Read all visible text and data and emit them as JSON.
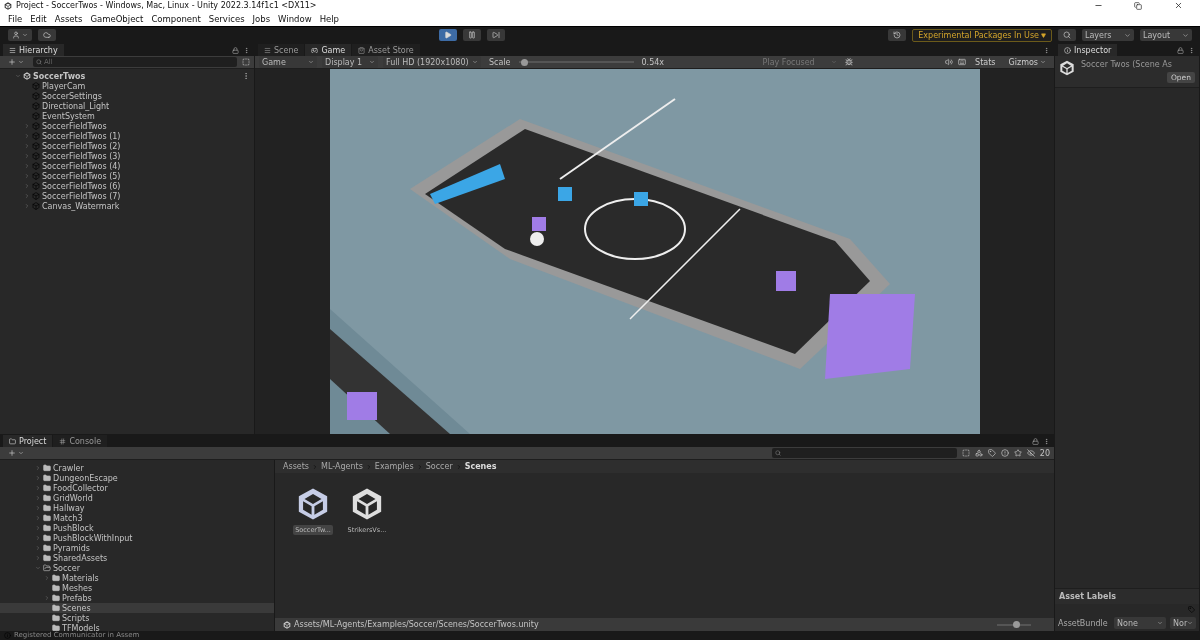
{
  "window": {
    "title": "Project - SoccerTwos - Windows, Mac, Linux - Unity 2022.3.14f1c1 <DX11>"
  },
  "menu": [
    "File",
    "Edit",
    "Assets",
    "GameObject",
    "Component",
    "Services",
    "Jobs",
    "Window",
    "Help"
  ],
  "toolbar": {
    "play": {
      "selected": true
    },
    "pause": {
      "selected": false
    },
    "step": {
      "selected": false
    },
    "packages_notice": "Experimental Packages In Use",
    "layers": "Layers",
    "layout": "Layout"
  },
  "hierarchy": {
    "title": "Hierarchy",
    "search_placeholder": "All",
    "items": [
      {
        "label": "SoccerTwos",
        "kind": "scene",
        "expanded": true,
        "children": [
          {
            "label": "PlayerCam",
            "kind": "object"
          },
          {
            "label": "SoccerSettings",
            "kind": "object"
          },
          {
            "label": "Directional_Light",
            "kind": "object"
          },
          {
            "label": "EventSystem",
            "kind": "object"
          },
          {
            "label": "SoccerFieldTwos",
            "kind": "object",
            "expanded": false
          },
          {
            "label": "SoccerFieldTwos (1)",
            "kind": "object",
            "expanded": false
          },
          {
            "label": "SoccerFieldTwos (2)",
            "kind": "object",
            "expanded": false
          },
          {
            "label": "SoccerFieldTwos (3)",
            "kind": "object",
            "expanded": false
          },
          {
            "label": "SoccerFieldTwos (4)",
            "kind": "object",
            "expanded": false
          },
          {
            "label": "SoccerFieldTwos (5)",
            "kind": "object",
            "expanded": false
          },
          {
            "label": "SoccerFieldTwos (6)",
            "kind": "object",
            "expanded": false
          },
          {
            "label": "SoccerFieldTwos (7)",
            "kind": "object",
            "expanded": false
          },
          {
            "label": "Canvas_Watermark",
            "kind": "object",
            "expanded": false
          }
        ]
      }
    ]
  },
  "view_tabs": [
    {
      "label": "Scene",
      "selected": false,
      "kind": "scene"
    },
    {
      "label": "Game",
      "selected": true,
      "kind": "game"
    },
    {
      "label": "Asset Store",
      "selected": false,
      "kind": "store"
    }
  ],
  "game_bar": {
    "mode": "Game",
    "display": "Display 1",
    "resolution": "Full HD (1920x1080)",
    "scale_label": "Scale",
    "scale": {
      "level": 0.02
    },
    "scale_value": "0.54x",
    "play_focused": "Play Focused",
    "stats": "Stats",
    "gizmos": "Gizmos"
  },
  "inspector": {
    "title": "Inspector",
    "asset": "Soccer Twos (Scene As",
    "open": "Open",
    "labels_title": "Asset Labels",
    "bundle_label": "AssetBundle",
    "bundle": "None",
    "variant": "Nor"
  },
  "bottom_tabs": [
    {
      "label": "Project",
      "selected": true,
      "kind": "project"
    },
    {
      "label": "Console",
      "selected": false,
      "kind": "console"
    }
  ],
  "project_tree": [
    {
      "label": "Crawler",
      "expanded": false,
      "selected": false
    },
    {
      "label": "DungeonEscape",
      "expanded": false,
      "selected": false
    },
    {
      "label": "FoodCollector",
      "expanded": false,
      "selected": false
    },
    {
      "label": "GridWorld",
      "expanded": false,
      "selected": false
    },
    {
      "label": "Hallway",
      "expanded": false,
      "selected": false
    },
    {
      "label": "Match3",
      "expanded": false,
      "selected": false
    },
    {
      "label": "PushBlock",
      "expanded": false,
      "selected": false
    },
    {
      "label": "PushBlockWithInput",
      "expanded": false,
      "selected": false
    },
    {
      "label": "Pyramids",
      "expanded": false,
      "selected": false
    },
    {
      "label": "SharedAssets",
      "expanded": false,
      "selected": false
    },
    {
      "label": "Soccer",
      "expanded": true,
      "selected": false,
      "children": [
        {
          "label": "Materials",
          "expanded": false,
          "selected": false
        },
        {
          "label": "Meshes",
          "selected": false
        },
        {
          "label": "Prefabs",
          "expanded": false,
          "selected": false
        },
        {
          "label": "Scenes",
          "selected": true
        },
        {
          "label": "Scripts",
          "selected": false
        },
        {
          "label": "TFModels",
          "selected": false
        }
      ]
    }
  ],
  "breadcrumb": [
    "Assets",
    "ML-Agents",
    "Examples",
    "Soccer",
    "Scenes"
  ],
  "assets": [
    {
      "label": "SoccerTw...",
      "selected": true
    },
    {
      "label": "StrikersVs...",
      "selected": false
    }
  ],
  "hidden_count": "20",
  "asset_path": "Assets/ML-Agents/Examples/Soccer/Scenes/SoccerTwos.unity",
  "icon_size": {
    "level": 0.6
  },
  "status": "Registered Communicator in Assem"
}
